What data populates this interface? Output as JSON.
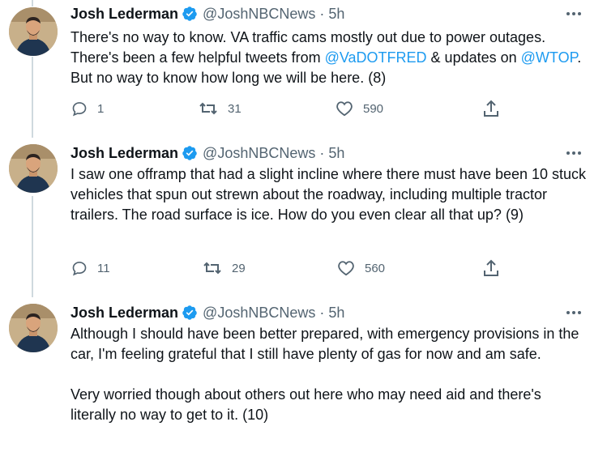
{
  "tweets": [
    {
      "author_name": "Josh Lederman",
      "handle": "@JoshNBCNews",
      "separator": "·",
      "time": "5h",
      "text_parts": [
        "There's no way to know. VA traffic cams mostly out due to power outages. There's been a few helpful tweets from ",
        "@VaDOTFRED",
        " & updates on ",
        "@WTOP",
        ". But no way to know how long we will be here. (8)"
      ],
      "replies": "1",
      "retweets": "31",
      "likes": "590"
    },
    {
      "author_name": "Josh Lederman",
      "handle": "@JoshNBCNews",
      "separator": "·",
      "time": "5h",
      "text": "I saw one offramp that had a slight incline where there must have been 10 stuck vehicles that spun out strewn about the roadway, including multiple tractor trailers. The road surface is ice. How do you even clear all that up? (9)",
      "replies": "11",
      "retweets": "29",
      "likes": "560"
    },
    {
      "author_name": "Josh Lederman",
      "handle": "@JoshNBCNews",
      "separator": "·",
      "time": "5h",
      "paragraph1": "Although I should have been better prepared, with emergency provisions in the car, I'm feeling grateful that I still have plenty of gas for now and am safe.",
      "paragraph2": "Very worried though about others out here who may need aid and there's literally no way to get to it. (10)"
    }
  ],
  "colors": {
    "link": "#1d9bf0",
    "verified": "#1d9bf0",
    "secondary_text": "#536471",
    "thread_line": "#cfd9de"
  },
  "icons": [
    "reply-icon",
    "retweet-icon",
    "like-icon",
    "share-icon",
    "more-icon",
    "verified-badge-icon"
  ]
}
